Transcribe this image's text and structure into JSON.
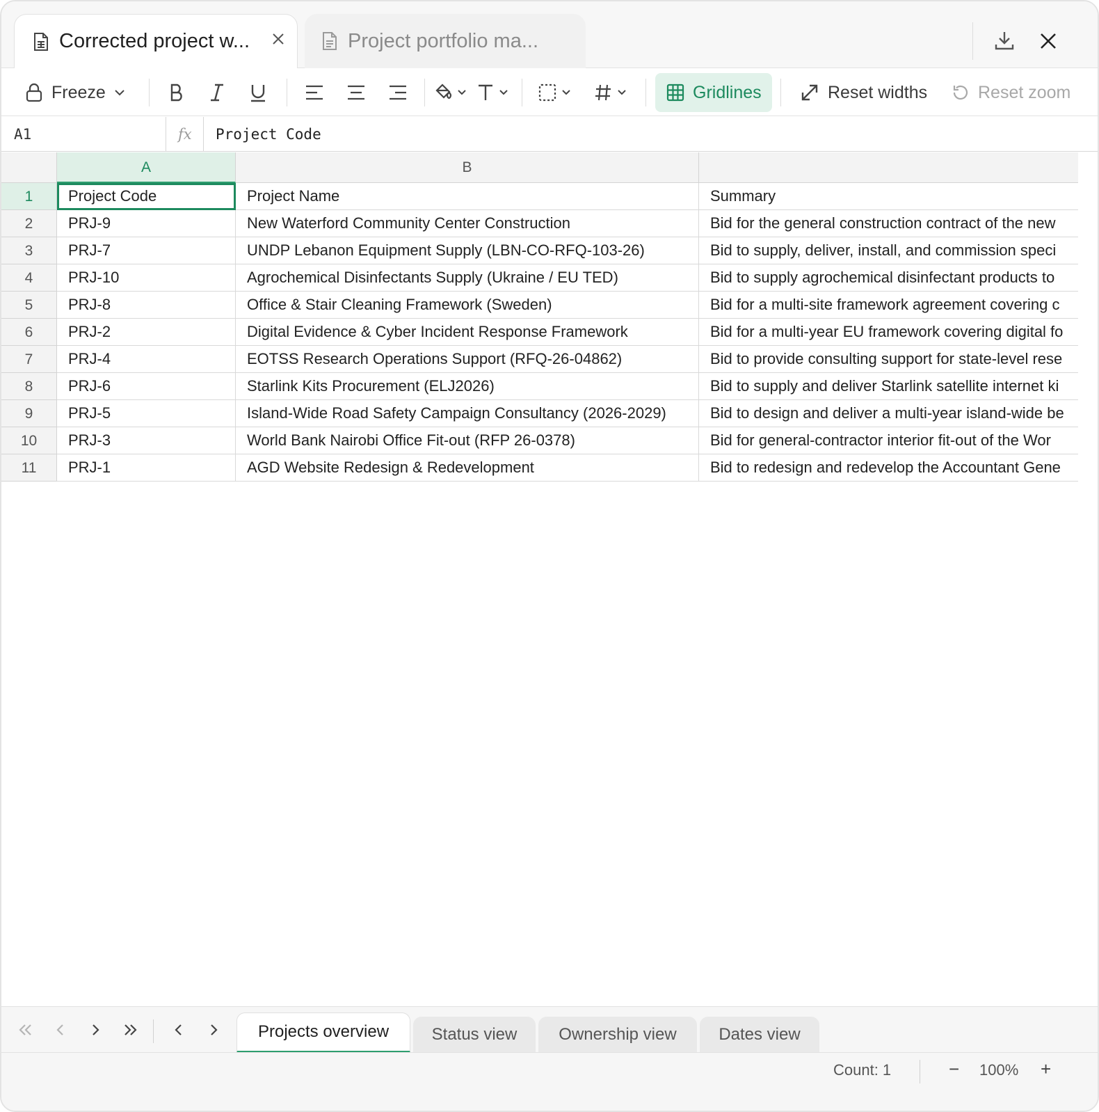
{
  "tabs": [
    {
      "title": "Corrected project w...",
      "active": true
    },
    {
      "title": "Project portfolio ma...",
      "active": false
    }
  ],
  "toolbar": {
    "freeze_label": "Freeze",
    "gridlines_label": "Gridlines",
    "reset_widths_label": "Reset widths",
    "reset_zoom_label": "Reset zoom",
    "accent_color": "#1d8a5e"
  },
  "formula_bar": {
    "cell_ref": "A1",
    "fx_label": "fx",
    "value": "Project Code"
  },
  "grid": {
    "columns": [
      "A",
      "B",
      ""
    ],
    "rows": [
      {
        "num": "1",
        "cells": [
          "Project Code",
          "Project Name",
          "Summary"
        ]
      },
      {
        "num": "2",
        "cells": [
          "PRJ-9",
          "New Waterford Community Center Construction",
          "Bid for the general construction contract of the new"
        ]
      },
      {
        "num": "3",
        "cells": [
          "PRJ-7",
          "UNDP Lebanon Equipment Supply (LBN-CO-RFQ-103-26)",
          "Bid to supply, deliver, install, and commission speci"
        ]
      },
      {
        "num": "4",
        "cells": [
          "PRJ-10",
          "Agrochemical Disinfectants Supply (Ukraine / EU TED)",
          "Bid to supply agrochemical disinfectant products to"
        ]
      },
      {
        "num": "5",
        "cells": [
          "PRJ-8",
          "Office & Stair Cleaning Framework (Sweden)",
          "Bid for a multi-site framework agreement covering c"
        ]
      },
      {
        "num": "6",
        "cells": [
          "PRJ-2",
          "Digital Evidence & Cyber Incident Response Framework",
          "Bid for a multi-year EU framework covering digital fo"
        ]
      },
      {
        "num": "7",
        "cells": [
          "PRJ-4",
          "EOTSS Research Operations Support (RFQ-26-04862)",
          "Bid to provide consulting support for state-level rese"
        ]
      },
      {
        "num": "8",
        "cells": [
          "PRJ-6",
          "Starlink Kits Procurement (ELJ2026)",
          "Bid to supply and deliver Starlink satellite internet ki"
        ]
      },
      {
        "num": "9",
        "cells": [
          "PRJ-5",
          "Island-Wide Road Safety Campaign Consultancy (2026-2029)",
          "Bid to design and deliver a multi-year island-wide be"
        ]
      },
      {
        "num": "10",
        "cells": [
          "PRJ-3",
          "World Bank Nairobi Office Fit-out (RFP 26-0378)",
          "Bid for general-contractor interior fit-out of the Wor"
        ]
      },
      {
        "num": "11",
        "cells": [
          "PRJ-1",
          "AGD Website Redesign & Redevelopment",
          "Bid to redesign and redevelop the Accountant Gene"
        ]
      }
    ]
  },
  "sheets": [
    {
      "label": "Projects overview",
      "active": true
    },
    {
      "label": "Status view",
      "active": false
    },
    {
      "label": "Ownership view",
      "active": false
    },
    {
      "label": "Dates view",
      "active": false
    }
  ],
  "status": {
    "count": "Count: 1",
    "zoom": "100%",
    "zoom_minus": "−",
    "zoom_plus": "+"
  }
}
